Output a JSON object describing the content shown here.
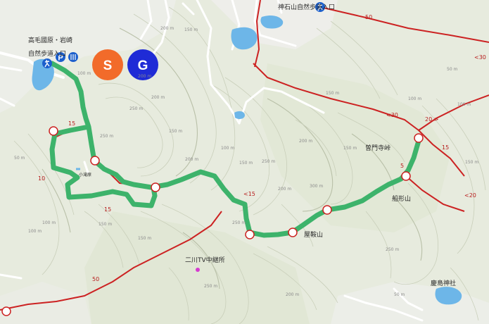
{
  "markers": {
    "start": "S",
    "goal": "G",
    "start_color": "#f26b2a",
    "goal_color": "#1f2bd6",
    "route_color": "#3db36b"
  },
  "place_labels": {
    "trailhead_line1": "高毛國原・岩崎",
    "trailhead_line2": "自然歩道入口",
    "top_trailhead": "神石山自然歩道入口",
    "pass": "曽門寺峠",
    "funagata": "船形山",
    "kuraoka": "屋鞍山",
    "nigawa_tv": "二川TV中継所",
    "shrine": "慶島神社",
    "small_spot": "小滝原"
  },
  "icons": {
    "parking": "P",
    "toilet": "toilet-icon",
    "hiker": "hiker-icon"
  },
  "road_numbers": {
    "top_right_50": "50",
    "right_30": "<30",
    "mid_30": "<30",
    "mid_20": "20 >",
    "right_15": "15",
    "right_20": "<20",
    "route_15_left": "15",
    "route_10": "10",
    "route_15_mid": "15",
    "route_15_center": "<15",
    "route_5": "5",
    "bottom_50": "50"
  },
  "elevation_labels": {
    "e1": "100 m",
    "e2": "200 m",
    "e3": "150 m",
    "e4": "200 m",
    "e5": "250 m",
    "e6": "200 m",
    "e7": "250 m",
    "e8": "150 m",
    "e9": "200 m",
    "e10": "100 m",
    "e11": "150 m",
    "e12": "250 m",
    "e13": "200 m",
    "e14": "150 m",
    "e15": "200 m",
    "e16": "150 m",
    "e17": "100 m",
    "e18": "50 m",
    "e19": "100 m",
    "e20": "150 m",
    "e21": "300 m",
    "e22": "250 m",
    "e23": "150 m",
    "e24": "100 m",
    "e25": "50 m",
    "e26": "100 m",
    "e27": "150 m",
    "e28": "250 m",
    "e29": "200 m",
    "e30": "250 m",
    "e31": "50 m"
  }
}
